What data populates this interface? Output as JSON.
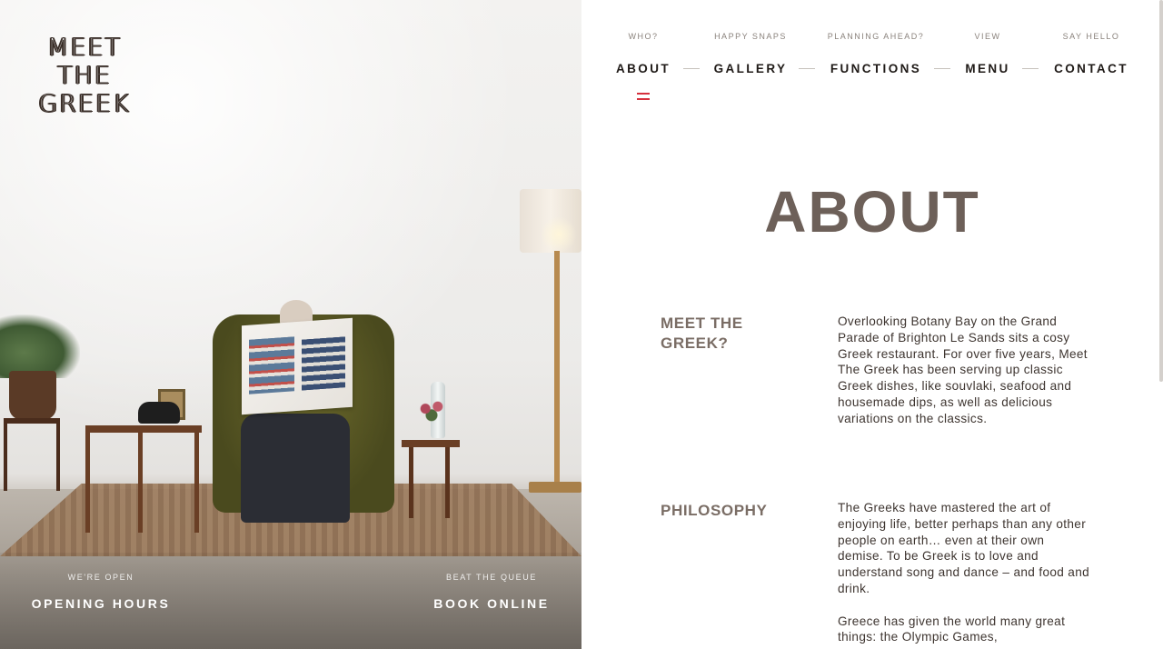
{
  "brand": {
    "logo_lines": [
      "MEET",
      "THE",
      "GREEK"
    ]
  },
  "hero": {
    "opening": {
      "kicker": "WE'RE OPEN",
      "label": "OPENING HOURS"
    },
    "booking": {
      "kicker": "BEAT THE QUEUE",
      "label": "BOOK ONLINE"
    }
  },
  "nav": {
    "items": [
      {
        "sub": "WHO?",
        "label": "ABOUT"
      },
      {
        "sub": "HAPPY SNAPS",
        "label": "GALLERY"
      },
      {
        "sub": "PLANNING AHEAD?",
        "label": "FUNCTIONS"
      },
      {
        "sub": "VIEW",
        "label": "MENU"
      },
      {
        "sub": "SAY HELLO",
        "label": "CONTACT"
      }
    ],
    "active_index": 0,
    "accent_color": "#d6313e"
  },
  "page": {
    "title": "ABOUT",
    "sections": [
      {
        "heading": "MEET THE GREEK?",
        "paragraphs": [
          "Overlooking Botany Bay on the Grand Parade of Brighton Le Sands sits a cosy Greek restaurant. For over five years, Meet The Greek has been serving up classic Greek dishes, like souvlaki, seafood and housemade dips, as well as delicious variations on the classics."
        ]
      },
      {
        "heading": "PHILOSOPHY",
        "paragraphs": [
          "The Greeks have mastered the art of enjoying life, better perhaps than any other people on earth… even at their own demise. To be Greek is to love and understand song and dance – and food and drink.",
          "Greece has given the world many great things: the Olympic Games,"
        ]
      }
    ]
  },
  "colors": {
    "heading": "#6d6059",
    "text": "#3e3530"
  }
}
